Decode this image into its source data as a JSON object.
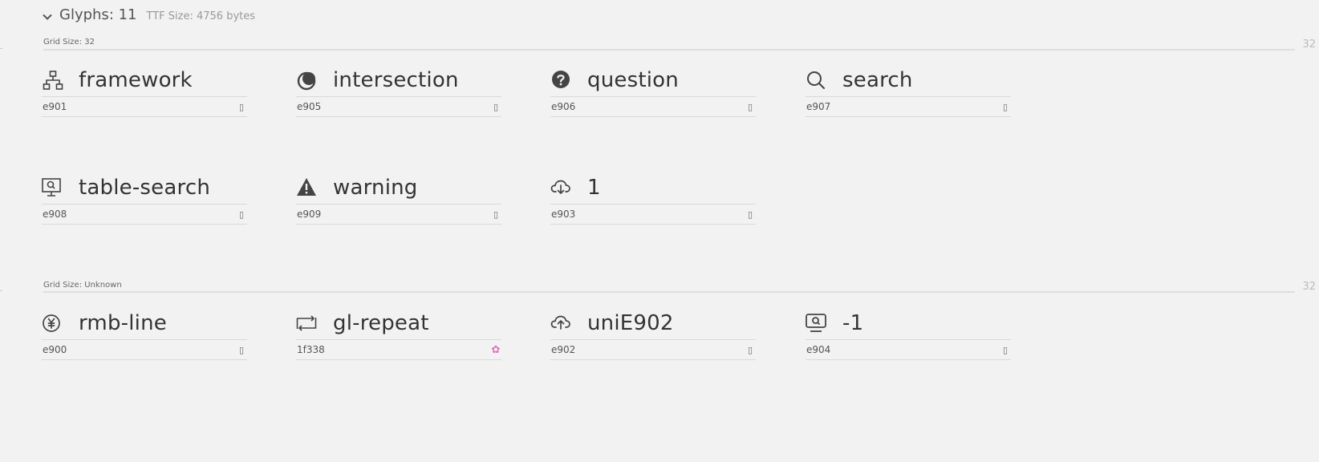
{
  "header": {
    "title": "Glyphs: 11",
    "subtitle": "TTF Size: 4756 bytes"
  },
  "sections": [
    {
      "label": "Grid Size: 32",
      "right": "32",
      "glyphs": [
        {
          "name": "framework",
          "code": "e901",
          "char": "▯",
          "icon": "sitemap-icon"
        },
        {
          "name": "intersection",
          "code": "e905",
          "char": "▯",
          "icon": "intersection-icon"
        },
        {
          "name": "question",
          "code": "e906",
          "char": "▯",
          "icon": "question-circle-icon"
        },
        {
          "name": "search",
          "code": "e907",
          "char": "▯",
          "icon": "search-icon"
        },
        {
          "name": "table-search",
          "code": "e908",
          "char": "▯",
          "icon": "monitor-search-icon"
        },
        {
          "name": "warning",
          "code": "e909",
          "char": "▯",
          "icon": "warning-icon"
        },
        {
          "name": "1",
          "code": "e903",
          "char": "▯",
          "icon": "cloud-download-icon"
        }
      ]
    },
    {
      "label": "Grid Size: Unknown",
      "right": "32",
      "glyphs": [
        {
          "name": "rmb-line",
          "code": "e900",
          "char": "▯",
          "icon": "yuan-circle-icon"
        },
        {
          "name": "gl-repeat",
          "code": "1f338",
          "char": "✿",
          "icon": "repeat-icon"
        },
        {
          "name": "uniE902",
          "code": "e902",
          "char": "▯",
          "icon": "cloud-upload-icon"
        },
        {
          "name": "-1",
          "code": "e904",
          "char": "▯",
          "icon": "monitor-search-icon"
        }
      ]
    }
  ],
  "colors": {
    "background": "#f2f2f2",
    "icon": "#444444",
    "emoji": "#e46cc4",
    "divider": "#d9d9d9"
  }
}
